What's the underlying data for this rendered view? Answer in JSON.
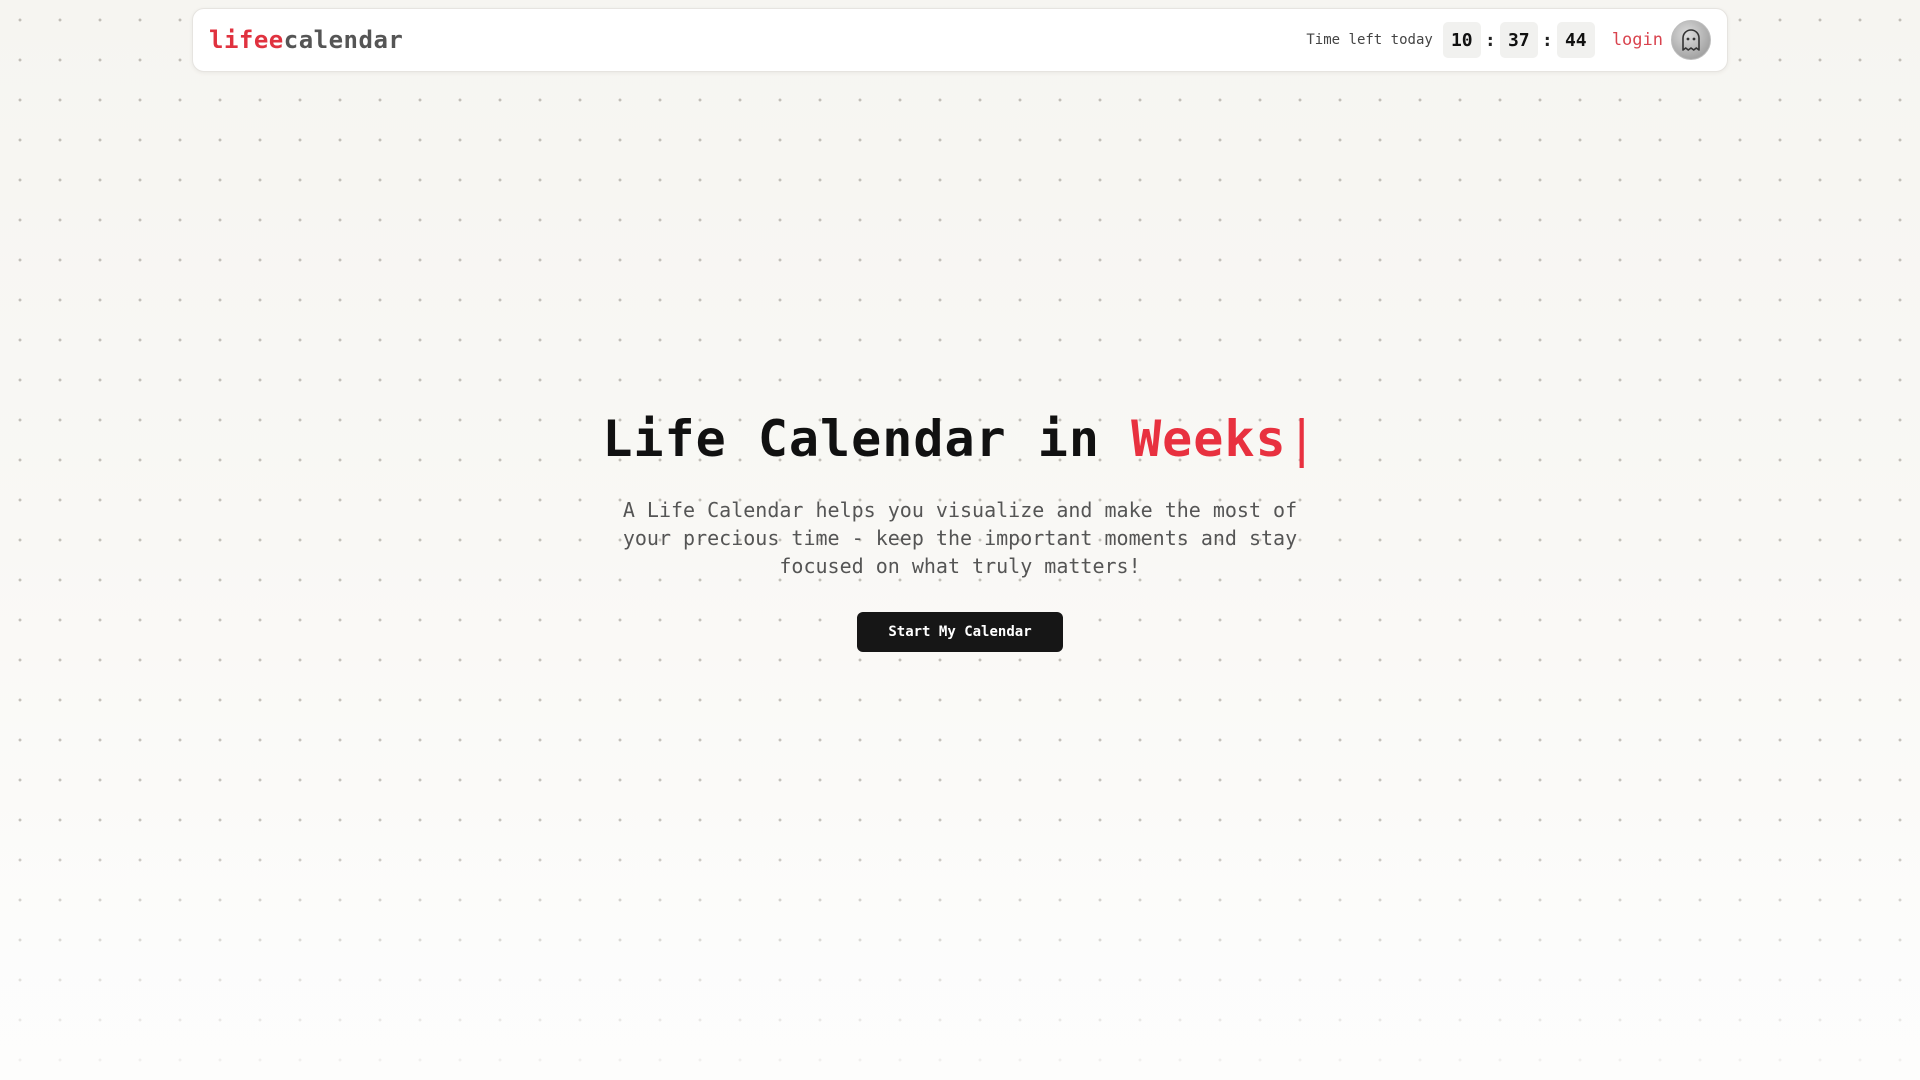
{
  "header": {
    "logo_accent": "lifee",
    "logo_rest": "calendar",
    "time_left_label": "Time left today",
    "hours": "10",
    "minutes": "37",
    "seconds": "44",
    "separator": ":",
    "login_label": "login",
    "avatar_icon": "ghost-icon"
  },
  "hero": {
    "title_prefix": "Life Calendar in ",
    "title_highlight": "Weeks",
    "cursor": "|",
    "description": "A Life Calendar helps you visualize and make the most of your precious time - keep the important moments and stay focused on what truly matters!",
    "cta_label": "Start My Calendar"
  },
  "colors": {
    "accent": "#e8313f",
    "button_bg": "#161616",
    "background": "#f8f7f3"
  }
}
